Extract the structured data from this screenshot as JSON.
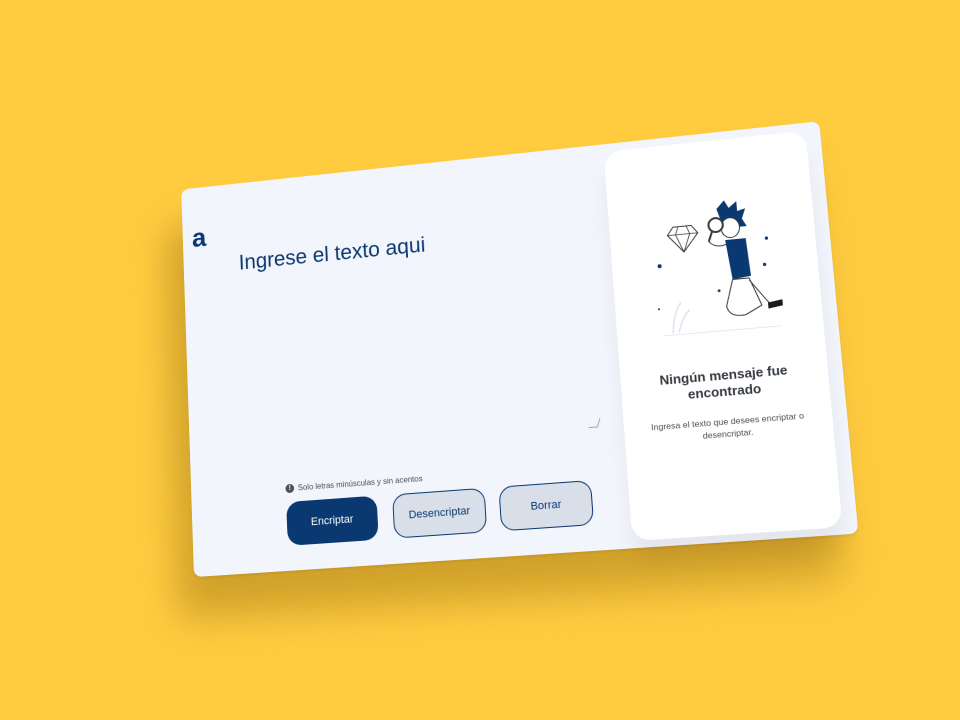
{
  "app": {
    "logo": "a"
  },
  "input": {
    "placeholder": "Ingrese el texto aqui"
  },
  "hint": {
    "icon": "info-icon",
    "text": "Solo letras minúsculas y sin acentos"
  },
  "buttons": {
    "encrypt": "Encriptar",
    "decrypt": "Desencriptar",
    "clear": "Borrar"
  },
  "result": {
    "illustration": "person-with-magnifier-illustration",
    "title": "Ningún mensaje fue encontrado",
    "description": "Ingresa el texto que desees encriptar o desencriptar."
  },
  "colors": {
    "background": "#FFCC3F",
    "primary": "#0A3871",
    "panel": "#F3F5FC",
    "result_panel": "#FFFFFF"
  }
}
